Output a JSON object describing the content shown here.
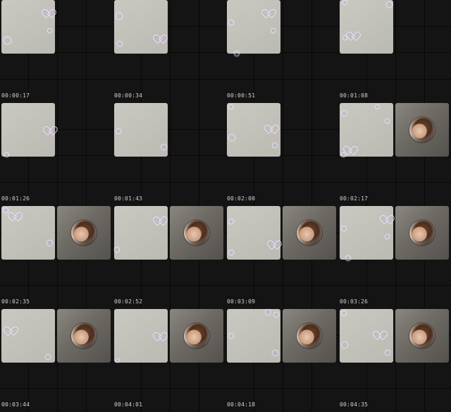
{
  "contact_sheet": {
    "timestamps": [
      "00:00:17",
      "00:00:34",
      "00:00:51",
      "00:01:08",
      "00:01:26",
      "00:01:43",
      "00:02:00",
      "00:02:17",
      "00:02:35",
      "00:02:52",
      "00:03:09",
      "00:03:26",
      "00:03:44",
      "00:04:01",
      "00:04:18",
      "00:04:35"
    ],
    "frames_with_avatar": [
      false,
      false,
      false,
      false,
      false,
      false,
      false,
      true,
      true,
      true,
      true,
      true,
      true,
      true,
      true,
      true
    ]
  }
}
